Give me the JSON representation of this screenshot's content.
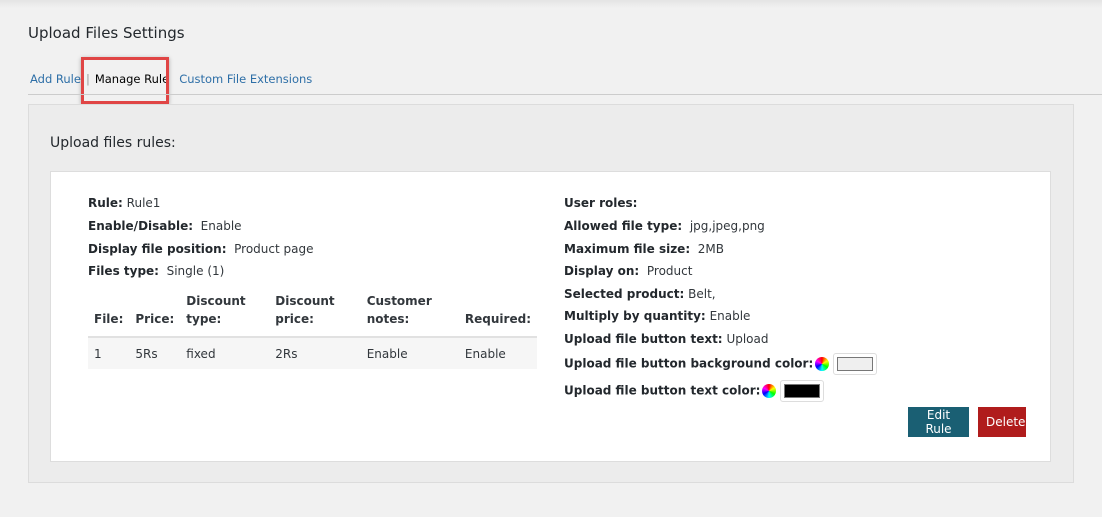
{
  "page_title": "Upload Files Settings",
  "tabs": [
    {
      "label": "Add Rule"
    },
    {
      "label": "Manage Rule",
      "active": true
    },
    {
      "label": "Custom File Extensions"
    }
  ],
  "section_title": "Upload files rules:",
  "rule": {
    "left": [
      {
        "label": "Rule:",
        "value": "Rule1"
      },
      {
        "label": "Enable/Disable:",
        "value": "Enable"
      },
      {
        "label": "Display file position:",
        "value": "Product page"
      },
      {
        "label": "Files type:",
        "value": "Single (1)"
      }
    ],
    "table": {
      "headers": [
        "File:",
        "Price:",
        "Discount type:",
        "Discount price:",
        "Customer notes:",
        "Required:"
      ],
      "rows": [
        [
          "1",
          "5Rs",
          "fixed",
          "2Rs",
          "Enable",
          "Enable"
        ]
      ]
    },
    "right": [
      {
        "label": "User roles:",
        "value": ""
      },
      {
        "label": "Allowed file type:",
        "value": "jpg,jpeg,png"
      },
      {
        "label": "Maximum file size:",
        "value": "2MB"
      },
      {
        "label": "Display on:",
        "value": "Product"
      },
      {
        "label": "Selected product:",
        "value": "Belt,"
      },
      {
        "label": "Multiply by quantity:",
        "value": "Enable"
      },
      {
        "label": "Upload file button text:",
        "value": "Upload"
      },
      {
        "label": "Upload file button background color:",
        "color": "#efefef",
        "icon": "color-wheel-icon"
      },
      {
        "label": "Upload file button text color:",
        "color": "#000000",
        "icon": "color-wheel-icon"
      }
    ],
    "edit_label": "Edit Rule",
    "delete_label": "Delete"
  },
  "colors": {
    "edit": "#1a5f73",
    "delete": "#b01c1c",
    "highlight": "#e04545"
  }
}
